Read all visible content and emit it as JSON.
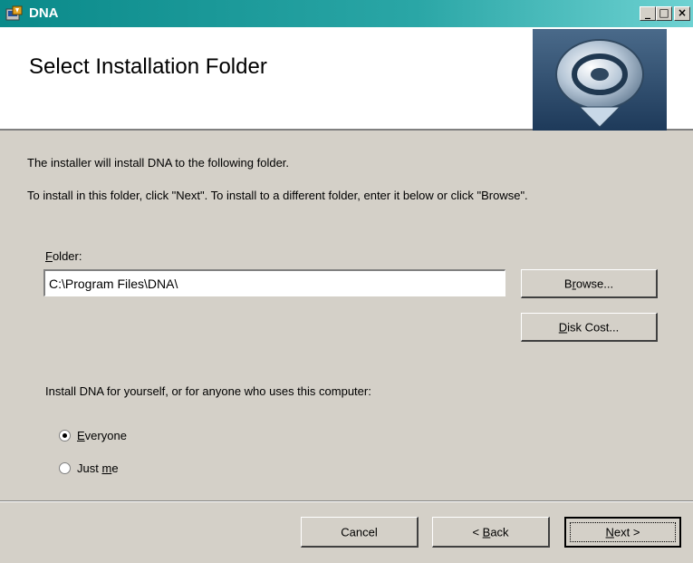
{
  "window": {
    "title": "DNA",
    "minimize_glyph": "_",
    "maximize_glyph": "□",
    "close_glyph": "×"
  },
  "banner": {
    "title": "Select Installation Folder"
  },
  "body": {
    "line1": "The installer will install DNA to the following folder.",
    "line2": "To install in this folder, click \"Next\". To install to a different folder, enter it below or click \"Browse\"."
  },
  "folder": {
    "label_mnemonic": "F",
    "label_rest": "older:",
    "value": "C:\\Program Files\\DNA\\"
  },
  "buttons": {
    "browse_pre": "B",
    "browse_mnemonic": "r",
    "browse_post": "owse...",
    "diskcost_mnemonic": "D",
    "diskcost_post": "isk Cost...",
    "cancel": "Cancel",
    "back_pre": "< ",
    "back_mnemonic": "B",
    "back_post": "ack",
    "next_mnemonic": "N",
    "next_post": "ext >"
  },
  "install_for": {
    "prompt": "Install DNA for yourself, or for anyone who uses this computer:",
    "options": [
      {
        "mnemonic": "E",
        "rest": "veryone",
        "selected": true
      },
      {
        "pre": "Just ",
        "mnemonic": "m",
        "rest": "e",
        "selected": false
      }
    ]
  },
  "icons": {
    "title": "installer-icon",
    "banner": "install-disc-logo"
  },
  "colors": {
    "titlebar": "#0a8a8a",
    "dialog_bg": "#d4d0c8"
  }
}
